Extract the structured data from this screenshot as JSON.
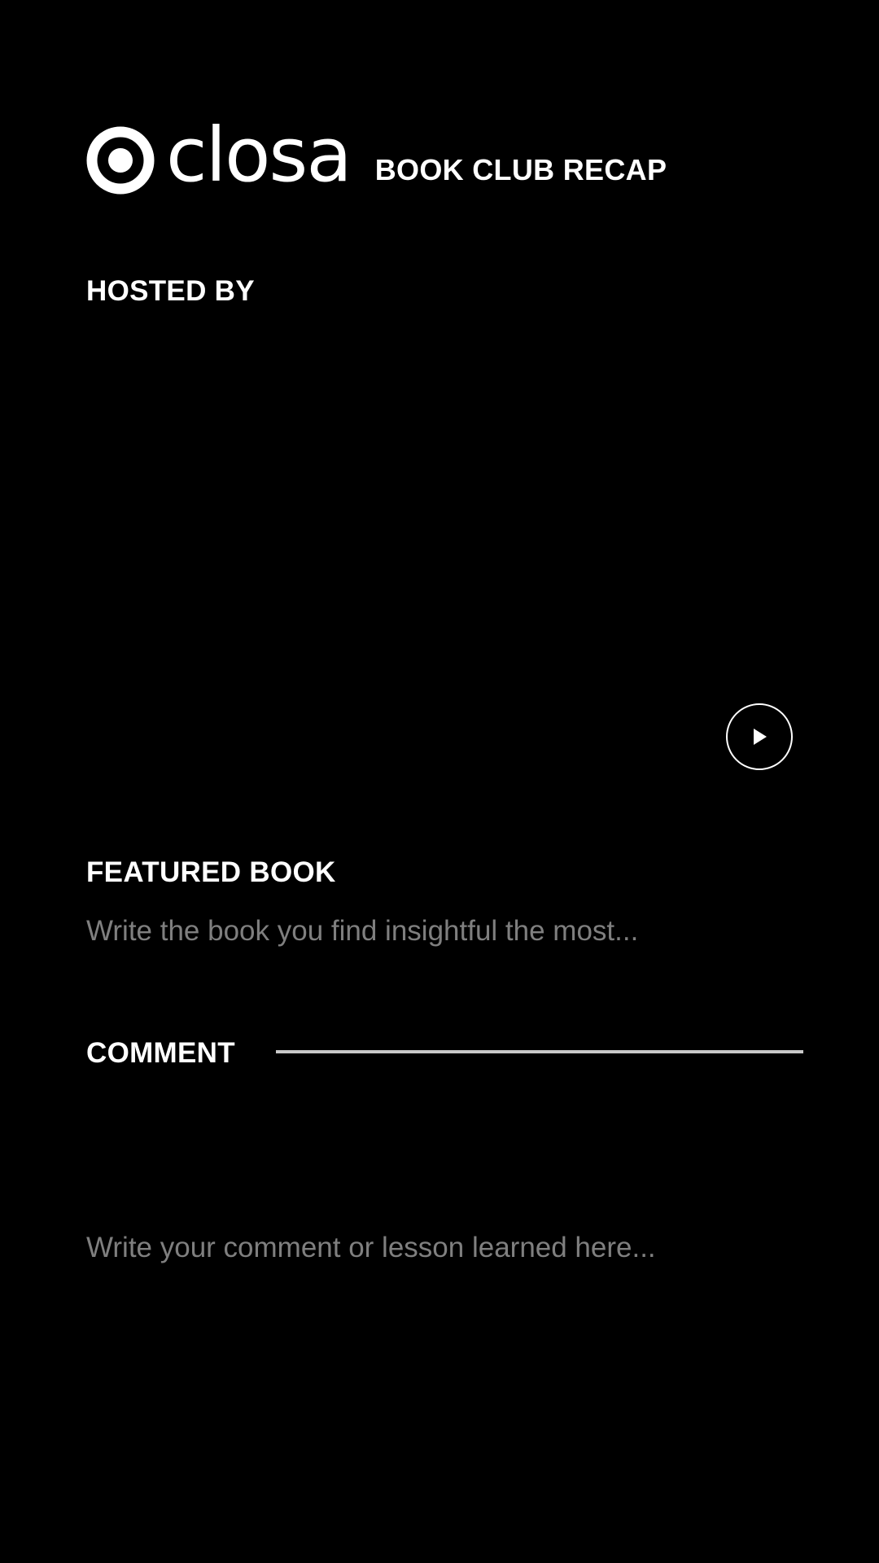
{
  "header": {
    "logo_icon": "target-circle-icon",
    "brand": "closa",
    "subtitle": "BOOK CLUB RECAP"
  },
  "hosted": {
    "heading": "HOSTED BY",
    "play_icon": "play-icon"
  },
  "featured": {
    "heading": "FEATURED BOOK",
    "placeholder": "Write the book you find insightful the most..."
  },
  "comment": {
    "heading": "COMMENT",
    "placeholder": "Write your comment or lesson learned here..."
  },
  "colors": {
    "background": "#000000",
    "text": "#ffffff",
    "placeholder": "#7f7f7f",
    "divider": "#c9c9c9"
  }
}
